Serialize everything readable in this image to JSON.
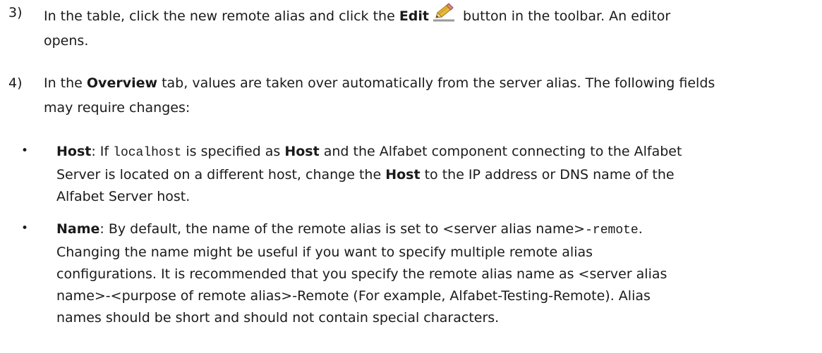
{
  "step3": {
    "number": "3)",
    "text_a": "In the table, click the new remote alias and click the ",
    "edit": "Edit",
    "text_b": " button in the toolbar. An editor",
    "text_c": "opens.",
    "edit_icon": "pencil-icon"
  },
  "step4": {
    "number": "4)",
    "text_a": "In the ",
    "overview": "Overview",
    "text_b": " tab, values are taken over automatically from the server alias. The following fields",
    "text_c": "may require changes:"
  },
  "bullet_host": {
    "dot": "•",
    "label": "Host",
    "t1": ": If ",
    "code": "localhost",
    "t2": " is specified as ",
    "host2": "Host",
    "t3": " and the Alfabet component connecting to the Alfabet",
    "t4": "Server is located on a different host, change the ",
    "host3": "Host",
    "t5": " to the IP address or DNS name of the",
    "t6": "Alfabet Server host."
  },
  "bullet_name": {
    "dot": "•",
    "label": "Name",
    "t1": ": By default, the name of the remote alias is set to <server alias name>",
    "code": "-remote",
    "t2": ".",
    "l2": "Changing the name might be useful if you want to specify multiple remote alias",
    "l3": "configurations. It is recommended that you specify the remote alias name as <server alias",
    "l4": "name>-<purpose of remote alias>-Remote (For example, Alfabet-Testing-Remote). Alias",
    "l5": "names should be short and should not contain special characters."
  }
}
